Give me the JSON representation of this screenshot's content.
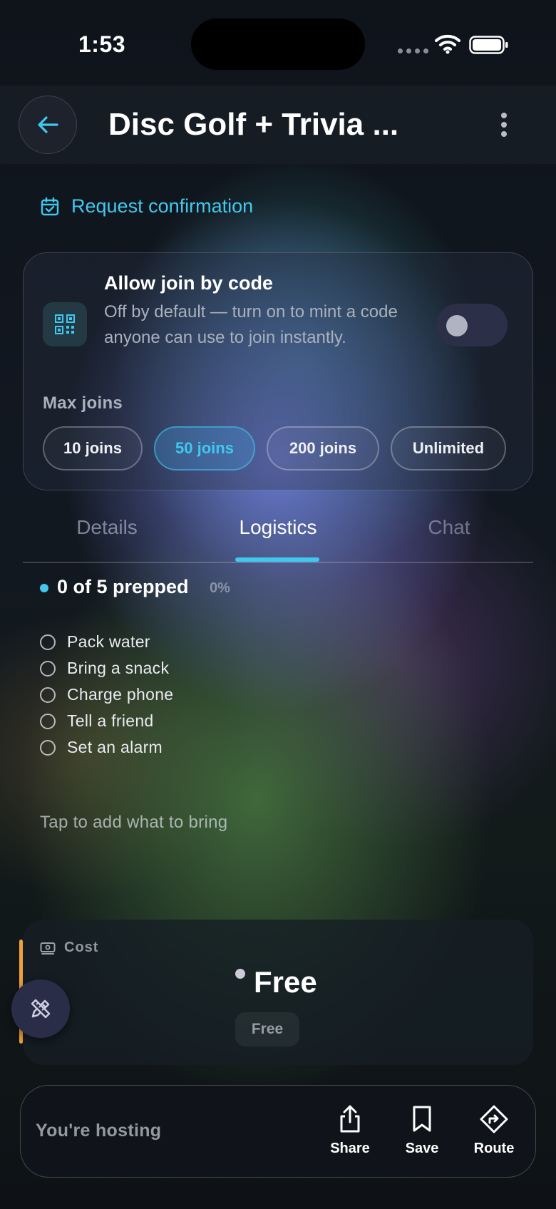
{
  "status_bar": {
    "time": "1:53"
  },
  "header": {
    "title": "Disc Golf + Trivia ..."
  },
  "request_confirmation": {
    "label": "Request confirmation"
  },
  "join_card": {
    "title": "Allow join by code",
    "description": "Off by default — turn on to mint a code anyone can use to join instantly.",
    "toggle_on": false,
    "max_joins_label": "Max joins",
    "options": [
      "10 joins",
      "50 joins",
      "200 joins",
      "Unlimited"
    ],
    "selected": "50 joins"
  },
  "tabs": {
    "details": "Details",
    "logistics": "Logistics",
    "chat": "Chat",
    "active": "Logistics"
  },
  "prep": {
    "summary": "0 of 5 prepped",
    "percent": "0%",
    "items": [
      "Pack water",
      "Bring a snack",
      "Charge phone",
      "Tell a friend",
      "Set an alarm"
    ],
    "add_hint": "Tap to add what to bring"
  },
  "cost": {
    "label": "Cost",
    "value": "Free",
    "chip": "Free"
  },
  "bottom_bar": {
    "hosting_label": "You're hosting",
    "share": "Share",
    "save": "Save",
    "route": "Route"
  },
  "colors": {
    "accent": "#41c8ef",
    "cost_accent": "#f0a13a",
    "background": "#0d1117"
  }
}
